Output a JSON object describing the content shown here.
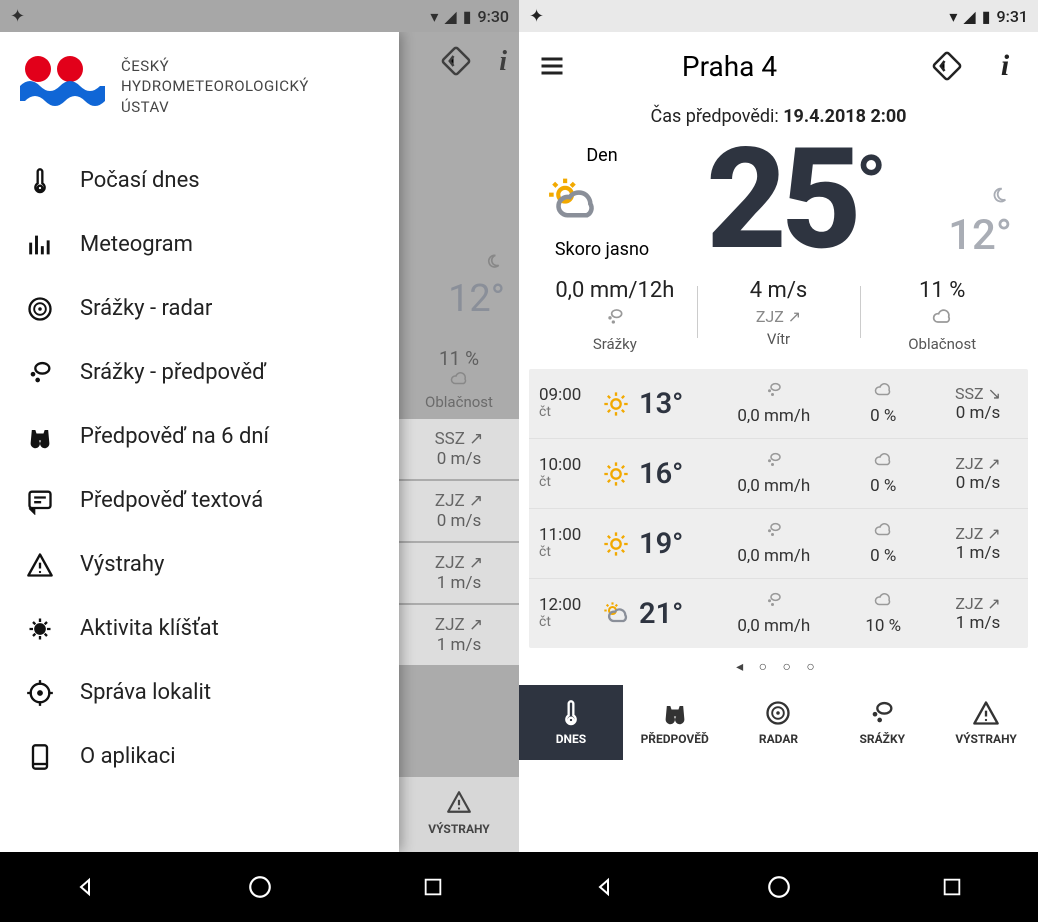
{
  "left": {
    "statusbar": {
      "time": "9:30"
    },
    "logo_text": {
      "l1": "ČESKÝ",
      "l2": "HYDROMETEOROLOGICKÝ",
      "l3": "ÚSTAV"
    },
    "menu": [
      {
        "icon": "thermometer",
        "label": "Počasí dnes"
      },
      {
        "icon": "bars",
        "label": "Meteogram"
      },
      {
        "icon": "radar",
        "label": "Srážky - radar"
      },
      {
        "icon": "rain",
        "label": "Srážky - předpověď"
      },
      {
        "icon": "binoculars",
        "label": "Předpověď na 6 dní"
      },
      {
        "icon": "text",
        "label": "Předpověď textová"
      },
      {
        "icon": "warning",
        "label": "Výstrahy"
      },
      {
        "icon": "tick",
        "label": "Aktivita klíšťat"
      },
      {
        "icon": "target",
        "label": "Správa lokalit"
      },
      {
        "icon": "phone",
        "label": "O aplikaci"
      }
    ],
    "bg": {
      "night_temp": "12°",
      "cloud_pct": "11 %",
      "cloud_label": "Oblačnost",
      "wind": [
        {
          "dir": "SSZ",
          "speed": "0 m/s"
        },
        {
          "dir": "ZJZ",
          "speed": "0 m/s"
        },
        {
          "dir": "ZJZ",
          "speed": "1 m/s"
        },
        {
          "dir": "ZJZ",
          "speed": "1 m/s"
        }
      ],
      "tab": "VÝSTRAHY"
    }
  },
  "right": {
    "statusbar": {
      "time": "9:31"
    },
    "title": "Praha 4",
    "forecast_time_label": "Čas předpovědi: ",
    "forecast_time_value": "19.4.2018 2:00",
    "hero": {
      "day_label": "Den",
      "condition": "Skoro jasno",
      "temp": "25",
      "night_temp": "12°"
    },
    "metrics": [
      {
        "value": "0,0 mm/12h",
        "sub": "",
        "label": "Srážky",
        "icon": "rain"
      },
      {
        "value": "4 m/s",
        "sub": "ZJZ ↗",
        "label": "Vítr",
        "icon": ""
      },
      {
        "value": "11 %",
        "sub": "",
        "label": "Oblačnost",
        "icon": "cloud"
      }
    ],
    "hourly": [
      {
        "time": "09:00",
        "day": "čt",
        "temp": "13°",
        "precip": "0,0 mm/h",
        "cloud": "0 %",
        "wind_dir": "SSZ",
        "wind_arrow": "↘",
        "wind": "0 m/s"
      },
      {
        "time": "10:00",
        "day": "čt",
        "temp": "16°",
        "precip": "0,0 mm/h",
        "cloud": "0 %",
        "wind_dir": "ZJZ",
        "wind_arrow": "↗",
        "wind": "0 m/s"
      },
      {
        "time": "11:00",
        "day": "čt",
        "temp": "19°",
        "precip": "0,0 mm/h",
        "cloud": "0 %",
        "wind_dir": "ZJZ",
        "wind_arrow": "↗",
        "wind": "1 m/s"
      },
      {
        "time": "12:00",
        "day": "čt",
        "temp": "21°",
        "precip": "0,0 mm/h",
        "cloud": "10 %",
        "wind_dir": "ZJZ",
        "wind_arrow": "↗",
        "wind": "1 m/s"
      }
    ],
    "tabs": [
      {
        "label": "DNES",
        "icon": "thermometer",
        "active": true
      },
      {
        "label": "PŘEDPOVĚĎ",
        "icon": "binoculars",
        "active": false
      },
      {
        "label": "RADAR",
        "icon": "radar",
        "active": false
      },
      {
        "label": "SRÁŽKY",
        "icon": "rain",
        "active": false
      },
      {
        "label": "VÝSTRAHY",
        "icon": "warning",
        "active": false
      }
    ]
  }
}
